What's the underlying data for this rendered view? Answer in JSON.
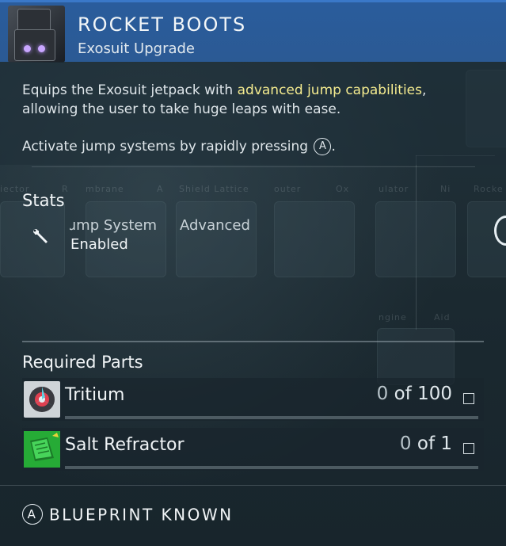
{
  "header": {
    "title": "ROCKET BOOTS",
    "subtitle": "Exosuit Upgrade",
    "icon": "rocket-boots-icon"
  },
  "description": {
    "before": "Equips the Exosuit jetpack with ",
    "highlight": "advanced jump capabilities",
    "after": ", allowing the user to take huge leaps with ease.",
    "activate_text": "Activate jump systems by rapidly pressing",
    "activate_button": "A",
    "highlight_color": "#f4eb8f"
  },
  "stats": {
    "title": "Stats",
    "items": [
      {
        "name": "Jump System",
        "value": "Enabled",
        "icon": "wrench-icon"
      },
      {
        "name": "Advanced",
        "value": ""
      }
    ]
  },
  "background_labels": [
    "iector",
    "R",
    "mbrane",
    "A",
    "Shield Lattice",
    "outer",
    "Ox",
    "ulator",
    "Ni",
    "Rocke",
    "ngine",
    "Aid"
  ],
  "required_parts": {
    "title": "Required Parts",
    "items": [
      {
        "name": "Tritium",
        "have": "0",
        "sep": " of ",
        "need": "100",
        "icon": "tritium-icon"
      },
      {
        "name": "Salt Refractor",
        "have": "0",
        "sep": " of ",
        "need": "1",
        "icon": "salt-refractor-icon"
      }
    ]
  },
  "footer": {
    "button": "A",
    "label": "BLUEPRINT KNOWN"
  },
  "colors": {
    "header_bg": "#2b5a94",
    "panel_bg": "#1c2b33",
    "tritium_bg": "#cfd4d8",
    "salt_bg": "#29b43a"
  }
}
